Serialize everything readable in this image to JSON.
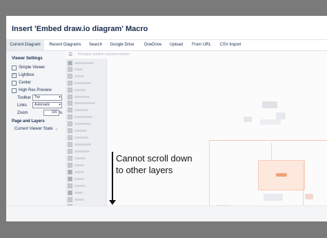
{
  "dialog": {
    "title": "Insert 'Embed draw.io diagram' Macro"
  },
  "tabs": [
    {
      "label": "Current Diagram",
      "active": true
    },
    {
      "label": "Recent Diagrams",
      "active": false
    },
    {
      "label": "Search",
      "active": false
    },
    {
      "label": "Google Drive",
      "active": false
    },
    {
      "label": "OneDrive",
      "active": false
    },
    {
      "label": "Upload",
      "active": false
    },
    {
      "label": "From URL",
      "active": false
    },
    {
      "label": "CSV Import",
      "active": false
    }
  ],
  "viewer_settings": {
    "heading": "Viewer Settings",
    "options": [
      {
        "label": "Simple Viewer",
        "checked": false
      },
      {
        "label": "Lightbox",
        "checked": true
      },
      {
        "label": "Center",
        "checked": false
      },
      {
        "label": "High Res Preview",
        "checked": false
      }
    ],
    "toolbar": {
      "label": "Toolbar",
      "value": "Top"
    },
    "links": {
      "label": "Links",
      "value": "Automatic"
    },
    "zoom": {
      "label": "Zoom",
      "value": "100",
      "unit": "%"
    }
  },
  "page_and_layers": {
    "heading": "Page and Layers",
    "current_viewer_state": "Current Viewer State →"
  },
  "canvas": {
    "file_name": "Principal solution overview.drawio"
  },
  "annotation": {
    "line1": "Cannot scroll down",
    "line2": "to other layers"
  },
  "colors": {
    "backdrop": "#7a7a7a",
    "dialog_bg": "#ffffff",
    "active_tab": "#e8ebef",
    "text": "#172b4d",
    "diagram_accent": "#f2a07b"
  }
}
